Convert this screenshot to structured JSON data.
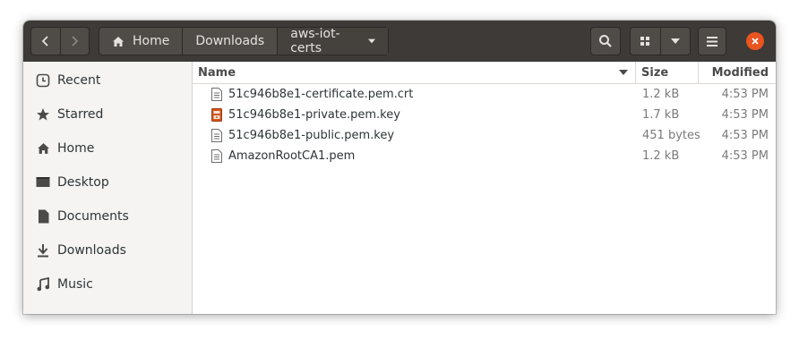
{
  "header": {
    "back_icon": "chevron-left-icon",
    "forward_icon": "chevron-right-icon",
    "breadcrumb": [
      {
        "label": "Home",
        "icon": "home-icon"
      },
      {
        "label": "Downloads"
      },
      {
        "label": "aws-iot-certs"
      }
    ],
    "search_icon": "search-icon",
    "view_icon": "grid-view-icon",
    "view_options_icon": "chevron-down-icon",
    "menu_icon": "hamburger-icon",
    "close_icon": "close-icon",
    "colors": {
      "headerbar": "#3d3a37",
      "close": "#e95420"
    }
  },
  "sidebar": {
    "items": [
      {
        "label": "Recent",
        "icon": "recent-icon"
      },
      {
        "label": "Starred",
        "icon": "star-icon"
      },
      {
        "label": "Home",
        "icon": "home-icon"
      },
      {
        "label": "Desktop",
        "icon": "desktop-icon"
      },
      {
        "label": "Documents",
        "icon": "documents-icon"
      },
      {
        "label": "Downloads",
        "icon": "downloads-icon"
      },
      {
        "label": "Music",
        "icon": "music-icon"
      }
    ]
  },
  "columns": {
    "name": "Name",
    "size": "Size",
    "modified": "Modified"
  },
  "files": [
    {
      "name": "51c946b8e1-certificate.pem.crt",
      "size": "1.2 kB",
      "modified": "4:53 PM",
      "icon": "text-file-icon"
    },
    {
      "name": "51c946b8e1-private.pem.key",
      "size": "1.7 kB",
      "modified": "4:53 PM",
      "icon": "key-file-icon"
    },
    {
      "name": "51c946b8e1-public.pem.key",
      "size": "451 bytes",
      "modified": "4:53 PM",
      "icon": "text-file-icon"
    },
    {
      "name": "AmazonRootCA1.pem",
      "size": "1.2 kB",
      "modified": "4:53 PM",
      "icon": "text-file-icon"
    }
  ]
}
